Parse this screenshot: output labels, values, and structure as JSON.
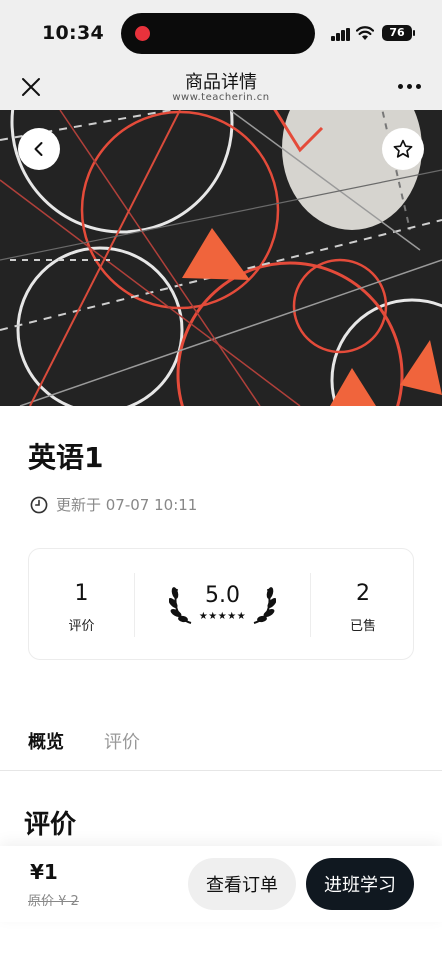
{
  "status_bar": {
    "time": "10:34",
    "battery": "76"
  },
  "nav": {
    "title": "商品详情",
    "subtitle": "www.teacherin.cn"
  },
  "course": {
    "title": "英语1",
    "updated": "更新于 07-07 10:11"
  },
  "stats": {
    "reviews_count": "1",
    "reviews_label": "评价",
    "rating": "5.0",
    "rating_stars": "★★★★★",
    "sold_count": "2",
    "sold_label": "已售"
  },
  "tabs": [
    {
      "label": "概览",
      "active": true
    },
    {
      "label": "评价",
      "active": false
    }
  ],
  "section": {
    "title": "评价"
  },
  "purchase": {
    "price": "¥1",
    "original_price": "原价 ¥ 2",
    "orders_button": "查看订单",
    "join_button": "进班学习"
  },
  "colors": {
    "accent_dark": "#101820",
    "hero_bg": "#232323",
    "hero_orange": "#f0643c",
    "record_dot": "#e8323c"
  }
}
